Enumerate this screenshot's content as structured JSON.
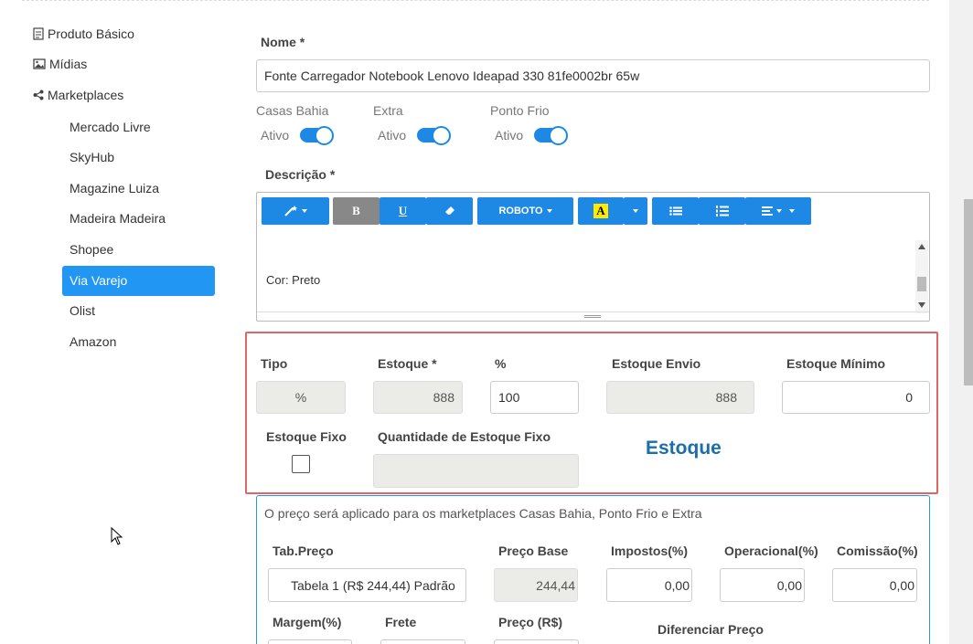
{
  "sidebar": {
    "produto_basico": "Produto Básico",
    "midias": "Mídias",
    "marketplaces": "Marketplaces",
    "items": [
      "Mercado Livre",
      "SkyHub",
      "Magazine Luiza",
      "Madeira Madeira",
      "Shopee",
      "Via Varejo",
      "Olist",
      "Amazon"
    ],
    "active_item": "Via Varejo"
  },
  "form": {
    "nome_label": "Nome *",
    "nome_value": "Fonte Carregador Notebook Lenovo Ideapad 330 81fe0002br 65w",
    "channels": [
      {
        "name": "Casas Bahia",
        "status": "Ativo"
      },
      {
        "name": "Extra",
        "status": "Ativo"
      },
      {
        "name": "Ponto Frio",
        "status": "Ativo"
      }
    ],
    "descricao_label": "Descrição *",
    "toolbar": {
      "font_label": "ROBOTO",
      "bold": "B",
      "underline": "U",
      "color": "A"
    },
    "editor_text": "Cor: Preto"
  },
  "estoque": {
    "tipo_label": "Tipo",
    "tipo_value": "%",
    "estoque_label": "Estoque *",
    "estoque_value": "888",
    "percent_label": "%",
    "percent_value": "100",
    "envio_label": "Estoque Envio",
    "envio_value": "888",
    "minimo_label": "Estoque Mínimo",
    "minimo_value": "0",
    "fixo_label": "Estoque Fixo",
    "qtd_fixo_label": "Quantidade de Estoque Fixo",
    "qtd_fixo_value": "",
    "section_title": "Estoque"
  },
  "preco": {
    "note": "O preço será aplicado para os marketplaces Casas Bahia, Ponto Frio e Extra",
    "tab_label": "Tab.Preço",
    "tab_value": "Tabela 1 (R$ 244,44) Padrão",
    "base_label": "Preço Base",
    "base_value": "244,44",
    "impostos_label": "Impostos(%)",
    "impostos_value": "0,00",
    "operacional_label": "Operacional(%)",
    "operacional_value": "0,00",
    "comissao_label": "Comissão(%)",
    "comissao_value": "0,00",
    "margem_label": "Margem(%)",
    "frete_label": "Frete",
    "preco_label": "Preço (R$)",
    "diferenciar_label": "Diferenciar Preço"
  },
  "colors": {
    "accent": "#2196f3",
    "highlight_border": "#e06666",
    "section_title": "#1b6fa8"
  }
}
